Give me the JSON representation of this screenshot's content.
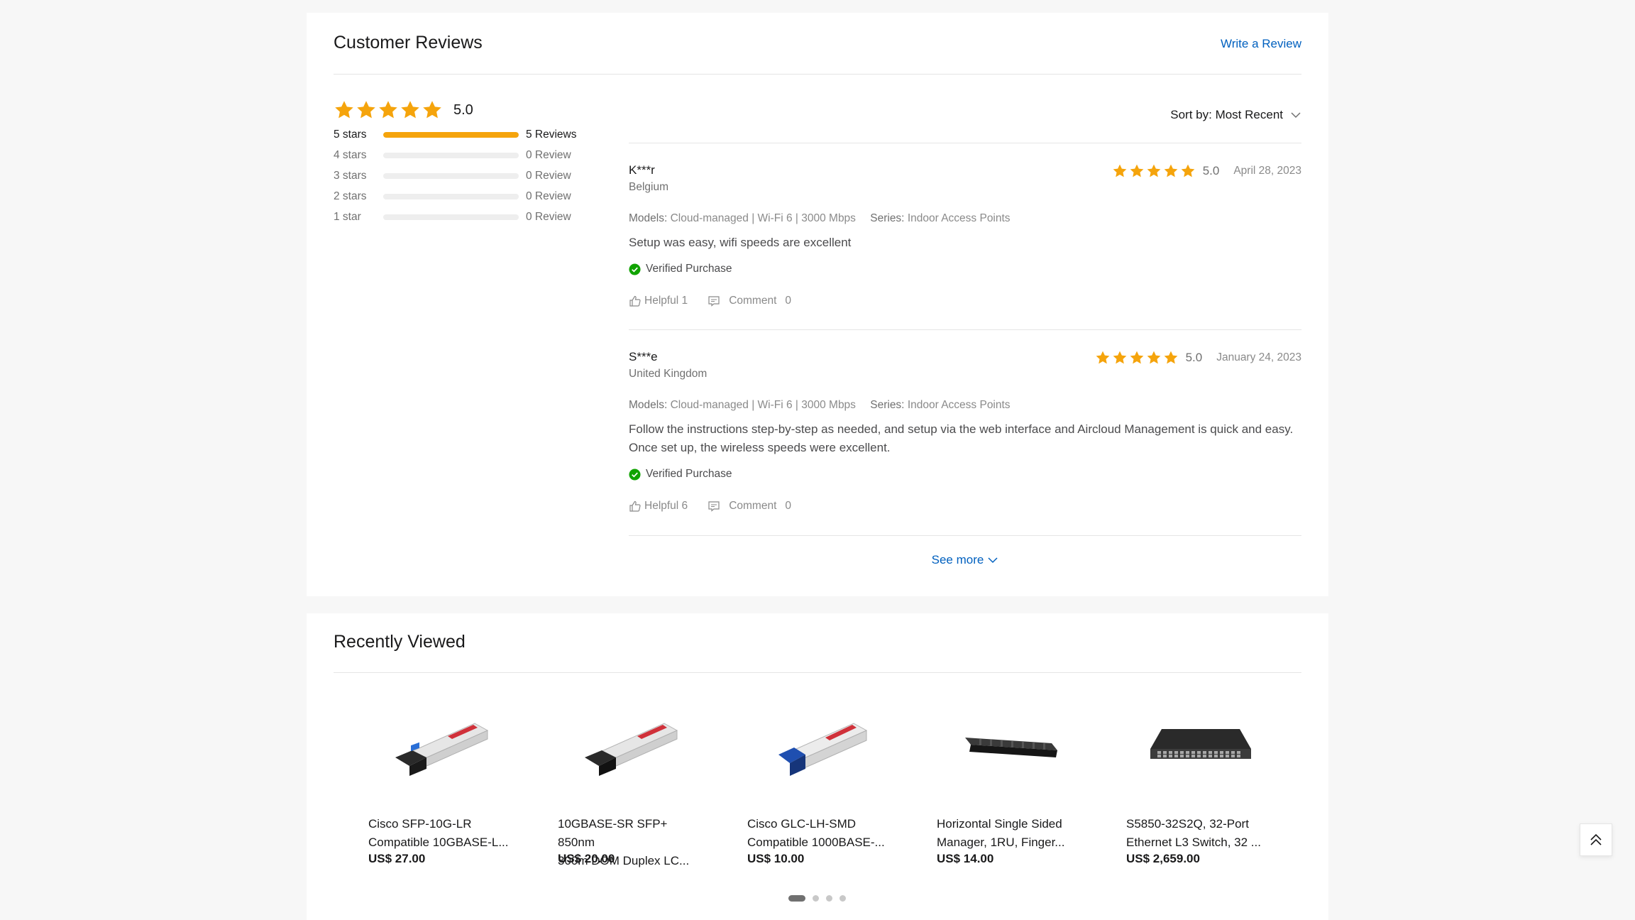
{
  "reviews": {
    "title": "Customer Reviews",
    "write_review": "Write a Review",
    "average_score": "5.0",
    "average_stars": 5,
    "distribution": [
      {
        "label": "5 stars",
        "count": "5 Reviews",
        "fraction": 1.0
      },
      {
        "label": "4 stars",
        "count": "0 Review",
        "fraction": 0
      },
      {
        "label": "3 stars",
        "count": "0 Review",
        "fraction": 0
      },
      {
        "label": "2 stars",
        "count": "0 Review",
        "fraction": 0
      },
      {
        "label": "1 star",
        "count": "0 Review",
        "fraction": 0
      }
    ],
    "sort_label": "Sort by: Most Recent",
    "items": [
      {
        "name": "K***r",
        "country": "Belgium",
        "score": "5.0",
        "stars": 5,
        "date": "April 28, 2023",
        "models_label": "Models:",
        "models_value": "Cloud-managed | Wi-Fi 6 | 3000 Mbps",
        "series_label": "Series:",
        "series_value": "Indoor Access Points",
        "text": "Setup was easy, wifi speeds are excellent",
        "verified": "Verified Purchase",
        "helpful": "Helpful 1",
        "comment": "Comment",
        "comment_count": "0"
      },
      {
        "name": "S***e",
        "country": "United Kingdom",
        "score": "5.0",
        "stars": 5,
        "date": "January 24, 2023",
        "models_label": "Models:",
        "models_value": "Cloud-managed | Wi-Fi 6 | 3000 Mbps",
        "series_label": "Series:",
        "series_value": "Indoor Access Points",
        "text": "Follow the instructions step-by-step as needed, and setup via the web interface and Aircloud Management is quick and easy. Once set up, the wireless speeds were excellent.",
        "verified": "Verified Purchase",
        "helpful": "Helpful 6",
        "comment": "Comment",
        "comment_count": "0"
      }
    ],
    "see_more": "See more"
  },
  "recent": {
    "title": "Recently Viewed",
    "products": [
      {
        "name_line1": "Cisco SFP-10G-LR",
        "name_line2": "Compatible 10GBASE-L...",
        "price": "US$ 27.00",
        "image": "sfp-module-blue"
      },
      {
        "name_line1": "10GBASE-SR SFP+ 850nm",
        "name_line2": "300m DOM Duplex LC...",
        "price": "US$ 20.00",
        "image": "sfp-module-black"
      },
      {
        "name_line1": "Cisco GLC-LH-SMD",
        "name_line2": "Compatible 1000BASE-...",
        "price": "US$ 10.00",
        "image": "sfp-module-blue"
      },
      {
        "name_line1": "Horizontal Single Sided",
        "name_line2": "Manager, 1RU, Finger...",
        "price": "US$ 14.00",
        "image": "cable-manager"
      },
      {
        "name_line1": "S5850-32S2Q, 32-Port",
        "name_line2": "Ethernet L3 Switch, 32 ...",
        "price": "US$ 2,659.00",
        "image": "network-switch"
      }
    ],
    "carousel_pages": 4,
    "carousel_active": 1
  },
  "colors": {
    "star": "#f5a40c",
    "link": "#0060bf",
    "verified": "#10a300"
  }
}
